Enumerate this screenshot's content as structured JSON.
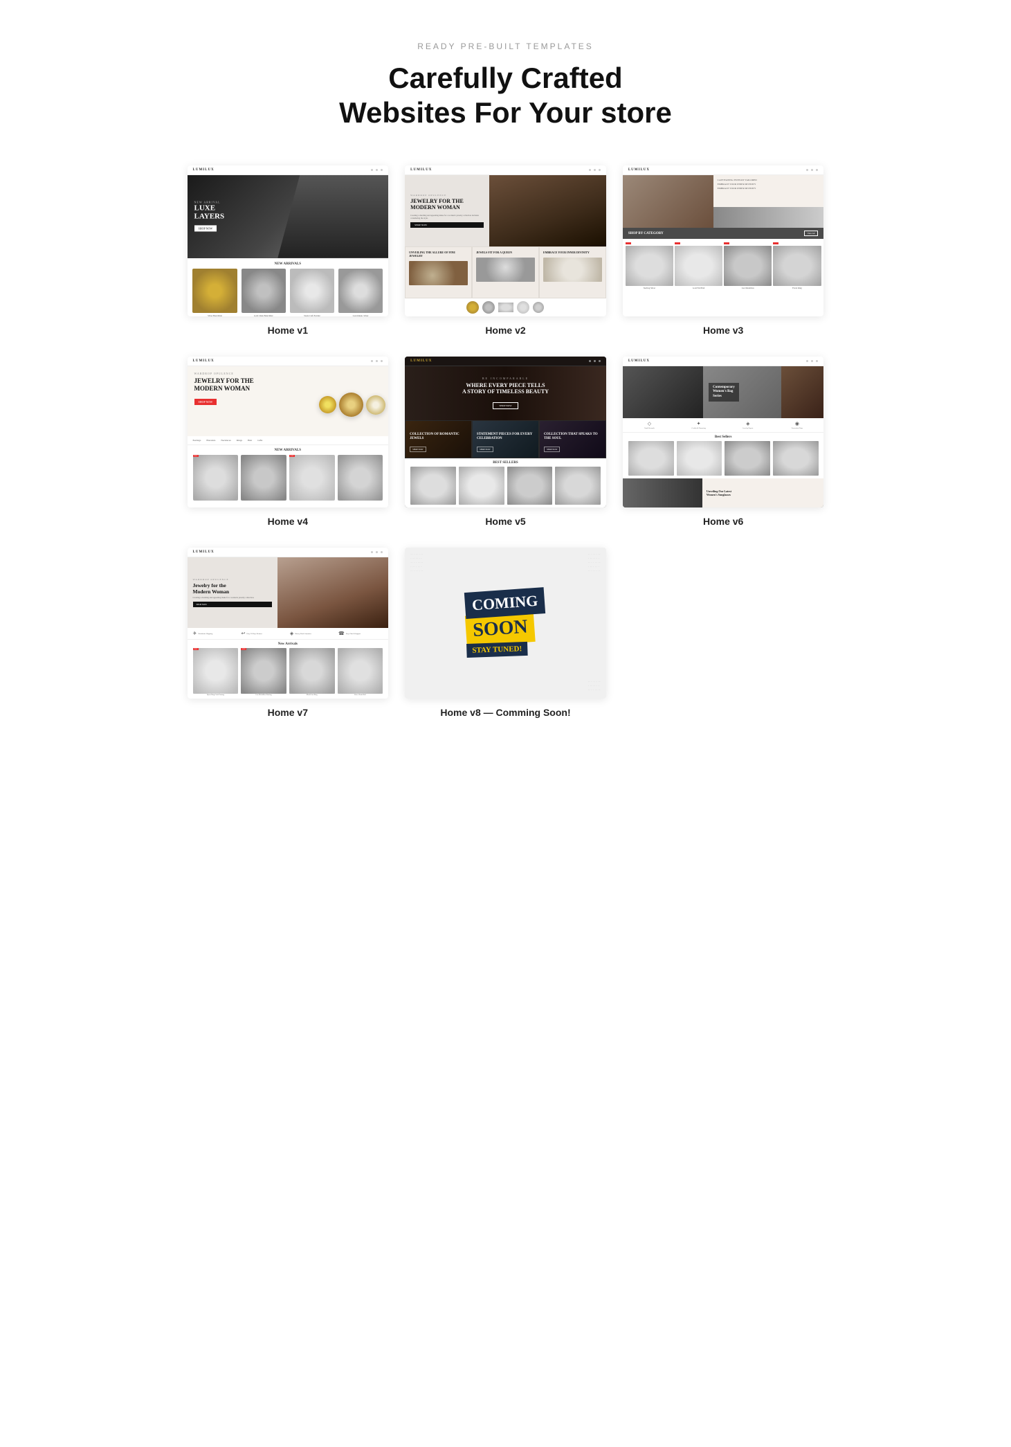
{
  "header": {
    "subtitle": "READY PRE-BUILT TEMPLATES",
    "title": "Carefully Crafted\nWebsites For Your store"
  },
  "templates": [
    {
      "id": "v1",
      "label": "Home v1",
      "brand": "LUMILUX",
      "hero_tag": "NEW ARRIVAL",
      "hero_title": "LUXE LAYERS",
      "hero_btn": "SHOP NOW",
      "section_title": "NEW ARRIVALS",
      "products": [
        {
          "name": "Silver Band Ring, Gold, Silver...",
          "img_class": "ring1"
        },
        {
          "name": "Gold Chain Band Ring, Sterling Silver...",
          "img_class": "ring2"
        },
        {
          "name": "Spark Craft Earring Set, 1 Piece...",
          "img_class": "ring3"
        },
        {
          "name": "Last minute, Silver...",
          "img_class": "ring4"
        }
      ]
    },
    {
      "id": "v2",
      "label": "Home v2",
      "brand": "LUMILUX",
      "hero_tag": "WARDROP OPULENCE",
      "hero_title": "JEWELRY FOR THE MODERN WOMAN",
      "hero_desc": "Creating a dazzling and appealing make for a women's jewelry collection includes considering the style, expert craftsmanship, and the modern woman.",
      "hero_btn": "SHOP NOW",
      "sub_sections": [
        {
          "title": "UNVEILING THE ALLURE OF FINE JEWELRY",
          "desc": ""
        },
        {
          "title": "JEWELS FIT FOR A QUEEN",
          "desc": ""
        },
        {
          "title": "EMBRACE YOUR INNER DIVINITY",
          "desc": ""
        }
      ]
    },
    {
      "id": "v3",
      "label": "Home v3",
      "features": [
        "CAPTIVATING JEWELRY TAILORED",
        "EMBRACE YOUR INNER DIVINITY",
        "EMBRACE YOUR INNER DIVINITY"
      ],
      "category_title": "SHOP BY CATEGORY",
      "category_btn": "View All",
      "products": [
        {
          "name": "Deco Diamond Ring, Sterling Silver...",
          "img_class": "g1"
        },
        {
          "name": "Gold Full Ball Necklace...",
          "img_class": "g2"
        },
        {
          "name": "Lux Medallion, Sterling Silver, 19803...",
          "img_class": "g3"
        },
        {
          "name": "Floral Ring, Gold, Gold Plated...",
          "img_class": "g4"
        }
      ]
    },
    {
      "id": "v4",
      "label": "Home v4",
      "brand": "LUMILUX",
      "hero_tag": "WARDROP OPULENCE",
      "hero_title": "JEWELRY FOR THE MODERN WOMAN",
      "hero_btn": "SHOP NOW",
      "nav_items": [
        "Earrings",
        "Bracelets",
        "Necklaces",
        "Rings",
        "Hair",
        "Gifts"
      ],
      "section_title": "NEW ARRIVALS",
      "products": [
        {
          "img_class": "r1"
        },
        {
          "img_class": "r2"
        },
        {
          "img_class": "r3"
        },
        {
          "img_class": "r4"
        }
      ]
    },
    {
      "id": "v5",
      "label": "Home v5",
      "brand": "LUMILUX",
      "hero_tag": "BE INCOMPARABLE",
      "hero_title": "WHERE EVERY PIECE TELLS A STORY OF TIMELESS BEAUTY",
      "hero_btn": "SHOP NOW",
      "collections": [
        {
          "title": "COLLECTION OF ROMANTIC JEWELS"
        },
        {
          "title": "STATEMENT PIECES FOR EVERY CELEBRATION"
        },
        {
          "title": "COLLECTION THAT SPEAKS TO THE SOUL"
        }
      ],
      "bestsellers_title": "BEST SELLERS",
      "products": [
        {
          "img_class": "b1"
        },
        {
          "img_class": "b2"
        },
        {
          "img_class": "b3"
        },
        {
          "img_class": "b4"
        }
      ]
    },
    {
      "id": "v6",
      "label": "Home v6",
      "brand": "LUMILUX",
      "series_title": "Contemporary\nWomen's Bag\nSeries",
      "features": [
        {
          "icon": "◇",
          "text": "Vault Rewards"
        },
        {
          "icon": "✦",
          "text": "Credits & Financing"
        },
        {
          "icon": "◈",
          "text": "Jewelry Expert"
        },
        {
          "icon": "◉",
          "text": "Protection Plans"
        }
      ],
      "bestsellers_title": "Best Sellers",
      "promo_text": "Unveiling Our Latest Women's Sunglasses"
    },
    {
      "id": "v7",
      "label": "Home v7",
      "brand": "LUMILUX",
      "hero_tag": "WARDROP OPULENCE",
      "hero_title": "Jewelry for the Modern Woman",
      "hero_desc": "Creating a dazzling and appealing make for a women's jewelry collection includes considering the style, expert craftsmanship, and the modern woman.",
      "hero_btn": "SHOP NOW",
      "features": [
        {
          "icon": "✈",
          "text": "Worldwide Shipping\nFrom about $100"
        },
        {
          "icon": "↩",
          "text": "Easy 30 Days Returns\nReturn within 30 days of purchase"
        },
        {
          "icon": "◈",
          "text": "Money-Back Guarantee\nWe ensure your policy"
        },
        {
          "icon": "☎",
          "text": "Easy Chat & Support\nReal-time support available"
        }
      ],
      "section_title": "New Arrivals",
      "products": [
        {
          "name": "Open-Ring Craft Earring, Sterling Silver...",
          "img_class": "p1"
        },
        {
          "name": "Lux Medallion, Earring Rock Gold...",
          "img_class": "p2"
        },
        {
          "name": "Mod-Coat Ring, Silver, Gold...",
          "img_class": "p3"
        },
        {
          "name": "Pixie Chain Ball Earring, Sterling Ring...",
          "img_class": "p4"
        }
      ]
    },
    {
      "id": "v8",
      "label": "Home v8 — Comming Soon!",
      "coming_text": "COMING",
      "soon_text": "SOON",
      "stay_text": "STAY TUNED!"
    }
  ]
}
